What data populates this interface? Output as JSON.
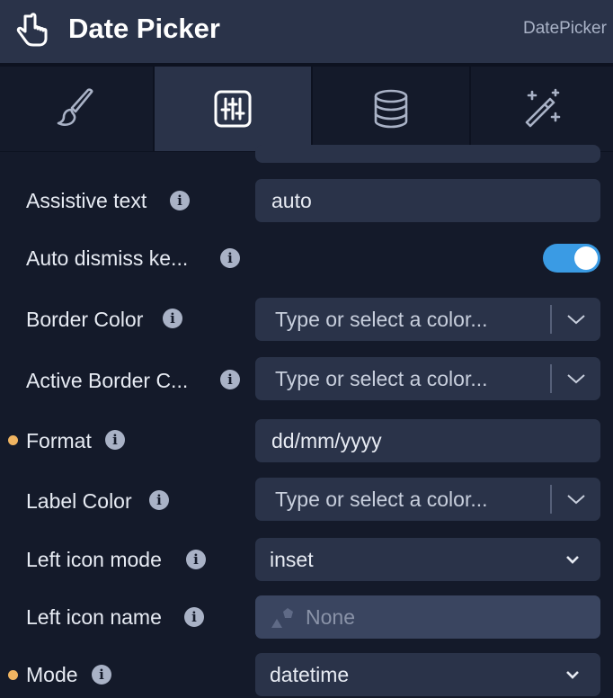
{
  "header": {
    "title": "Date Picker",
    "component_type": "DatePicker",
    "icon": "pointer-hand-icon"
  },
  "tabs": [
    {
      "icon": "paintbrush-icon",
      "active": false
    },
    {
      "icon": "sliders-icon",
      "active": true
    },
    {
      "icon": "database-icon",
      "active": false
    },
    {
      "icon": "magic-wand-icon",
      "active": false
    }
  ],
  "properties": {
    "assistive_text": {
      "label": "Assistive text",
      "value": "auto"
    },
    "auto_dismiss": {
      "label": "Auto dismiss ke...",
      "enabled": true
    },
    "border_color": {
      "label": "Border Color",
      "placeholder": "Type or select a color..."
    },
    "active_border_color": {
      "label": "Active Border C...",
      "placeholder": "Type or select a color..."
    },
    "format": {
      "label": "Format",
      "value": "dd/mm/yyyy",
      "modified": true
    },
    "label_color": {
      "label": "Label Color",
      "placeholder": "Type or select a color..."
    },
    "left_icon_mode": {
      "label": "Left icon mode",
      "value": "inset"
    },
    "left_icon_name": {
      "label": "Left icon name",
      "value": "None"
    },
    "mode": {
      "label": "Mode",
      "value": "datetime",
      "modified": true
    }
  },
  "colors": {
    "accent": "#3a9be4",
    "modified_dot": "#f0b461",
    "field_bg": "#2a3349",
    "panel_bg": "#141a2a"
  }
}
